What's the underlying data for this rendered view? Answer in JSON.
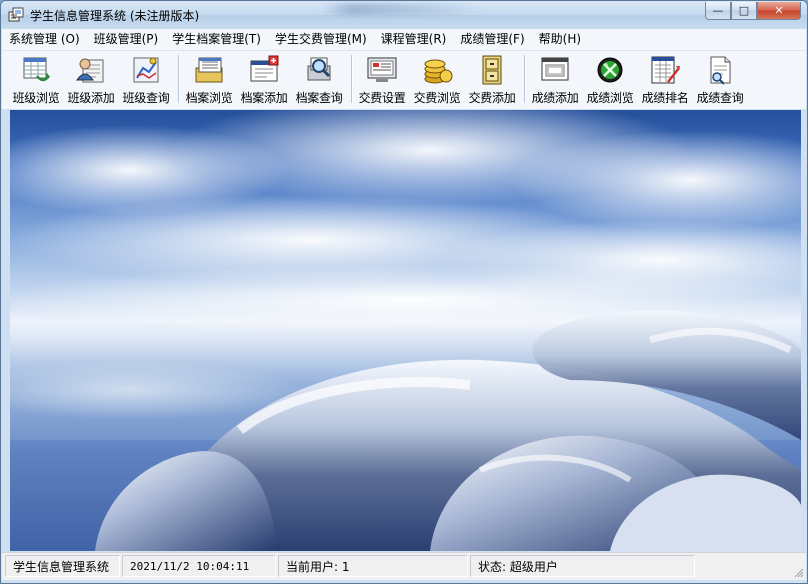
{
  "window": {
    "title": "学生信息管理系统 (未注册版本)",
    "caption": {
      "minimize": "—",
      "maximize": "□",
      "close": "✕"
    }
  },
  "menu": [
    "系统管理 (O)",
    "班级管理(P)",
    "学生档案管理(T)",
    "学生交费管理(M)",
    "课程管理(R)",
    "成绩管理(F)",
    "帮助(H)"
  ],
  "toolbar": [
    {
      "label": "班级浏览",
      "icon": "class-table-icon"
    },
    {
      "label": "班级添加",
      "icon": "class-user-add-icon"
    },
    {
      "label": "班级查询",
      "icon": "class-search-chart-icon"
    },
    {
      "label": "档案浏览",
      "icon": "archive-list-icon"
    },
    {
      "label": "档案添加",
      "icon": "archive-add-window-icon"
    },
    {
      "label": "档案查询",
      "icon": "archive-search-icon"
    },
    {
      "label": "交费设置",
      "icon": "fee-settings-monitor-icon"
    },
    {
      "label": "交费浏览",
      "icon": "fee-coins-icon"
    },
    {
      "label": "交费添加",
      "icon": "fee-cabinet-icon"
    },
    {
      "label": "成绩添加",
      "icon": "score-add-window-icon"
    },
    {
      "label": "成绩浏览",
      "icon": "score-browse-globe-icon"
    },
    {
      "label": "成绩排名",
      "icon": "score-rank-chart-icon"
    },
    {
      "label": "成绩查询",
      "icon": "score-search-document-icon"
    }
  ],
  "statusbar": {
    "app_name": "学生信息管理系统",
    "datetime": "2021/11/2 10:04:11",
    "current_user": "当前用户: 1",
    "status": "状态:  超级用户"
  },
  "colors": {
    "title_bar": "#c4d9ee",
    "menu_bg": "#f3f6fb",
    "close_button": "#c44226",
    "status_bg": "#f0f0f0"
  }
}
